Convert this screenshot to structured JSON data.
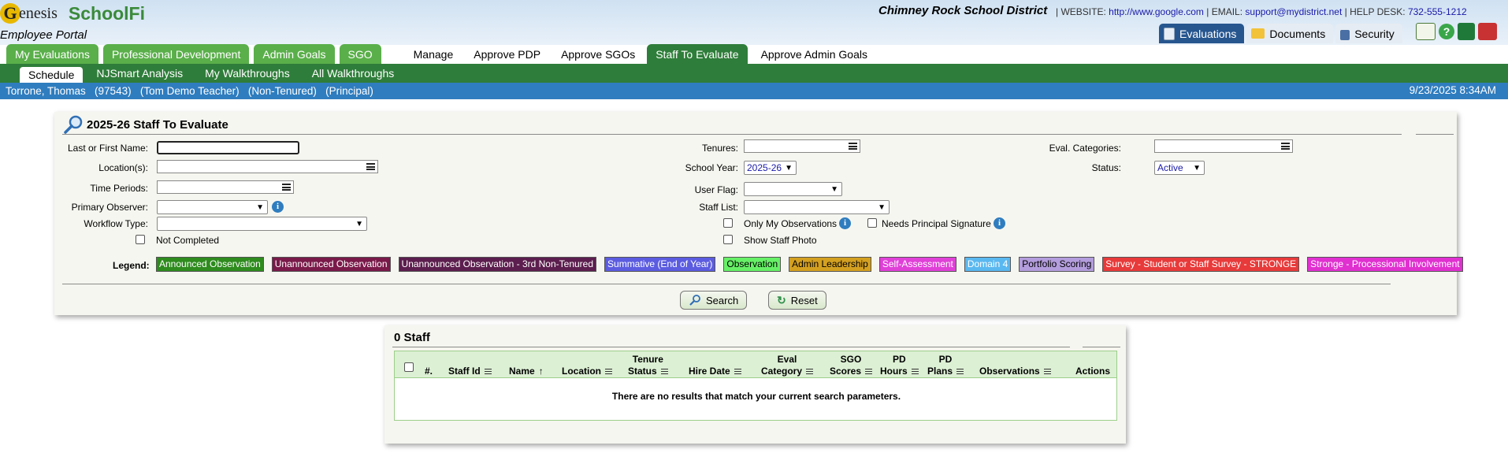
{
  "header": {
    "logo_genesis": "enesis",
    "logo_schoolfi": "SchoolFi",
    "portal": "Employee Portal",
    "district": "Chimney Rock School District",
    "website_label": "WEBSITE:",
    "website": "http://www.google.com",
    "email_label": "EMAIL:",
    "email": "support@mydistrict.net",
    "helpdesk_label": "HELP DESK:",
    "helpdesk": "732-555-1212",
    "tabs": [
      {
        "label": "Evaluations",
        "icon": "evaluation-icon"
      },
      {
        "label": "Documents",
        "icon": "folder-icon"
      },
      {
        "label": "Security",
        "icon": "lock-icon"
      }
    ],
    "icons": [
      "mail-icon",
      "help-icon",
      "excel-icon",
      "logout-icon"
    ]
  },
  "nav": {
    "main_tabs": [
      "My Evaluations",
      "Professional Development",
      "Admin Goals",
      "SGO"
    ],
    "action_tabs": [
      "Manage",
      "Approve PDP",
      "Approve SGOs",
      "Staff To Evaluate",
      "Approve Admin Goals"
    ],
    "sub_tabs": [
      "Schedule",
      "NJSmart Analysis",
      "My Walkthroughs",
      "All Walkthroughs"
    ]
  },
  "user": {
    "info": "Torrone, Thomas   (97543)   (Tom Demo Teacher)   (Non-Tenured)   (Principal)",
    "timestamp": "9/23/2025 8:34AM"
  },
  "search": {
    "title": "2025-26 Staff To Evaluate",
    "labels": {
      "name": "Last or First Name:",
      "locations": "Location(s):",
      "time_periods": "Time Periods:",
      "primary_observer": "Primary Observer:",
      "workflow_type": "Workflow Type:",
      "not_completed": "Not Completed",
      "tenures": "Tenures:",
      "school_year": "School Year:",
      "user_flag": "User Flag:",
      "staff_list": "Staff List:",
      "only_my_observations": "Only My Observations",
      "needs_principal_signature": "Needs Principal Signature",
      "show_staff_photo": "Show Staff Photo",
      "eval_categories": "Eval. Categories:",
      "status": "Status:"
    },
    "values": {
      "school_year": "2025-26",
      "status": "Active"
    },
    "legend_label": "Legend:",
    "legend": [
      {
        "label": "Announced Observation",
        "bg": "#2e8b1e",
        "fg": "#ffffff"
      },
      {
        "label": "Unannounced Observation",
        "bg": "#7a1a4a",
        "fg": "#ffffff"
      },
      {
        "label": "Unannounced Observation - 3rd Non-Tenured",
        "bg": "#5c1e4e",
        "fg": "#ffffff"
      },
      {
        "label": "Summative (End of Year)",
        "bg": "#5b5ce0",
        "fg": "#ffffff"
      },
      {
        "label": "Observation",
        "bg": "#66f066",
        "fg": "#000000"
      },
      {
        "label": "Admin Leadership",
        "bg": "#d4a020",
        "fg": "#000000"
      },
      {
        "label": "Self-Assessment",
        "bg": "#e040d8",
        "fg": "#ffffff"
      },
      {
        "label": "Domain 4",
        "bg": "#5ab8f0",
        "fg": "#ffffff"
      },
      {
        "label": "Portfolio Scoring",
        "bg": "#b39ddc",
        "fg": "#000000"
      },
      {
        "label": "Survey - Student or Staff Survey - STRONGE",
        "bg": "#e83a3a",
        "fg": "#ffffff"
      },
      {
        "label": "Stronge - Processional Involvement",
        "bg": "#e030d0",
        "fg": "#ffffff"
      }
    ],
    "search_button": "Search",
    "reset_button": "Reset"
  },
  "results": {
    "title": "0 Staff",
    "columns": [
      {
        "line1": "",
        "line2": "#."
      },
      {
        "line1": "",
        "line2": "Staff Id"
      },
      {
        "line1": "",
        "line2": "Name"
      },
      {
        "line1": "",
        "line2": "Location"
      },
      {
        "line1": "Tenure",
        "line2": "Status"
      },
      {
        "line1": "",
        "line2": "Hire Date"
      },
      {
        "line1": "Eval",
        "line2": "Category"
      },
      {
        "line1": "SGO",
        "line2": "Scores"
      },
      {
        "line1": "PD",
        "line2": "Hours"
      },
      {
        "line1": "PD",
        "line2": "Plans"
      },
      {
        "line1": "",
        "line2": "Observations"
      },
      {
        "line1": "",
        "line2": "Actions"
      }
    ],
    "empty_message": "There are no results that match your current search parameters."
  }
}
